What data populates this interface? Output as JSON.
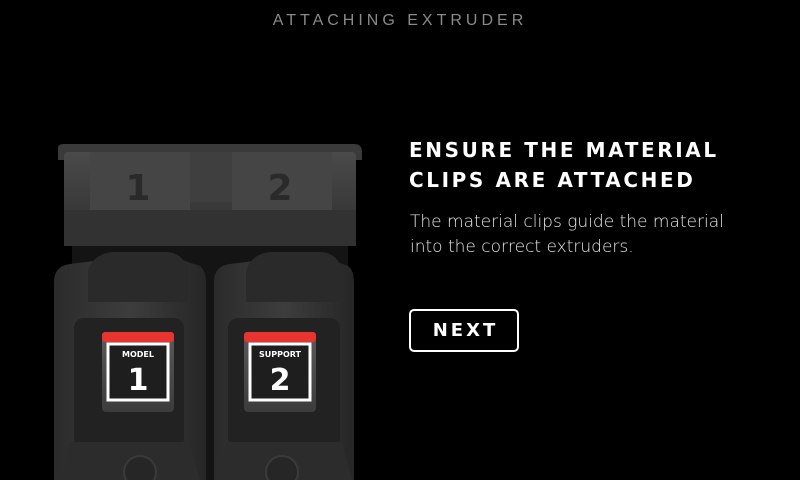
{
  "header": {
    "title": "ATTACHING EXTRUDER"
  },
  "illustration": {
    "slot_numbers": [
      "1",
      "2"
    ],
    "extruders": [
      {
        "label": "MODEL",
        "number": "1",
        "tab_color": "#e8342e"
      },
      {
        "label": "SUPPORT",
        "number": "2",
        "tab_color": "#e8342e"
      }
    ]
  },
  "content": {
    "heading_lines": [
      "ENSURE THE MATERIAL",
      "CLIPS ARE ATTACHED"
    ],
    "body_lines": [
      "The material clips guide the material",
      "into the correct extruders."
    ]
  },
  "actions": {
    "next_label": "NEXT"
  },
  "colors": {
    "background": "#000000",
    "accent_red": "#e8342e",
    "header_gray": "#8a8a8a"
  }
}
